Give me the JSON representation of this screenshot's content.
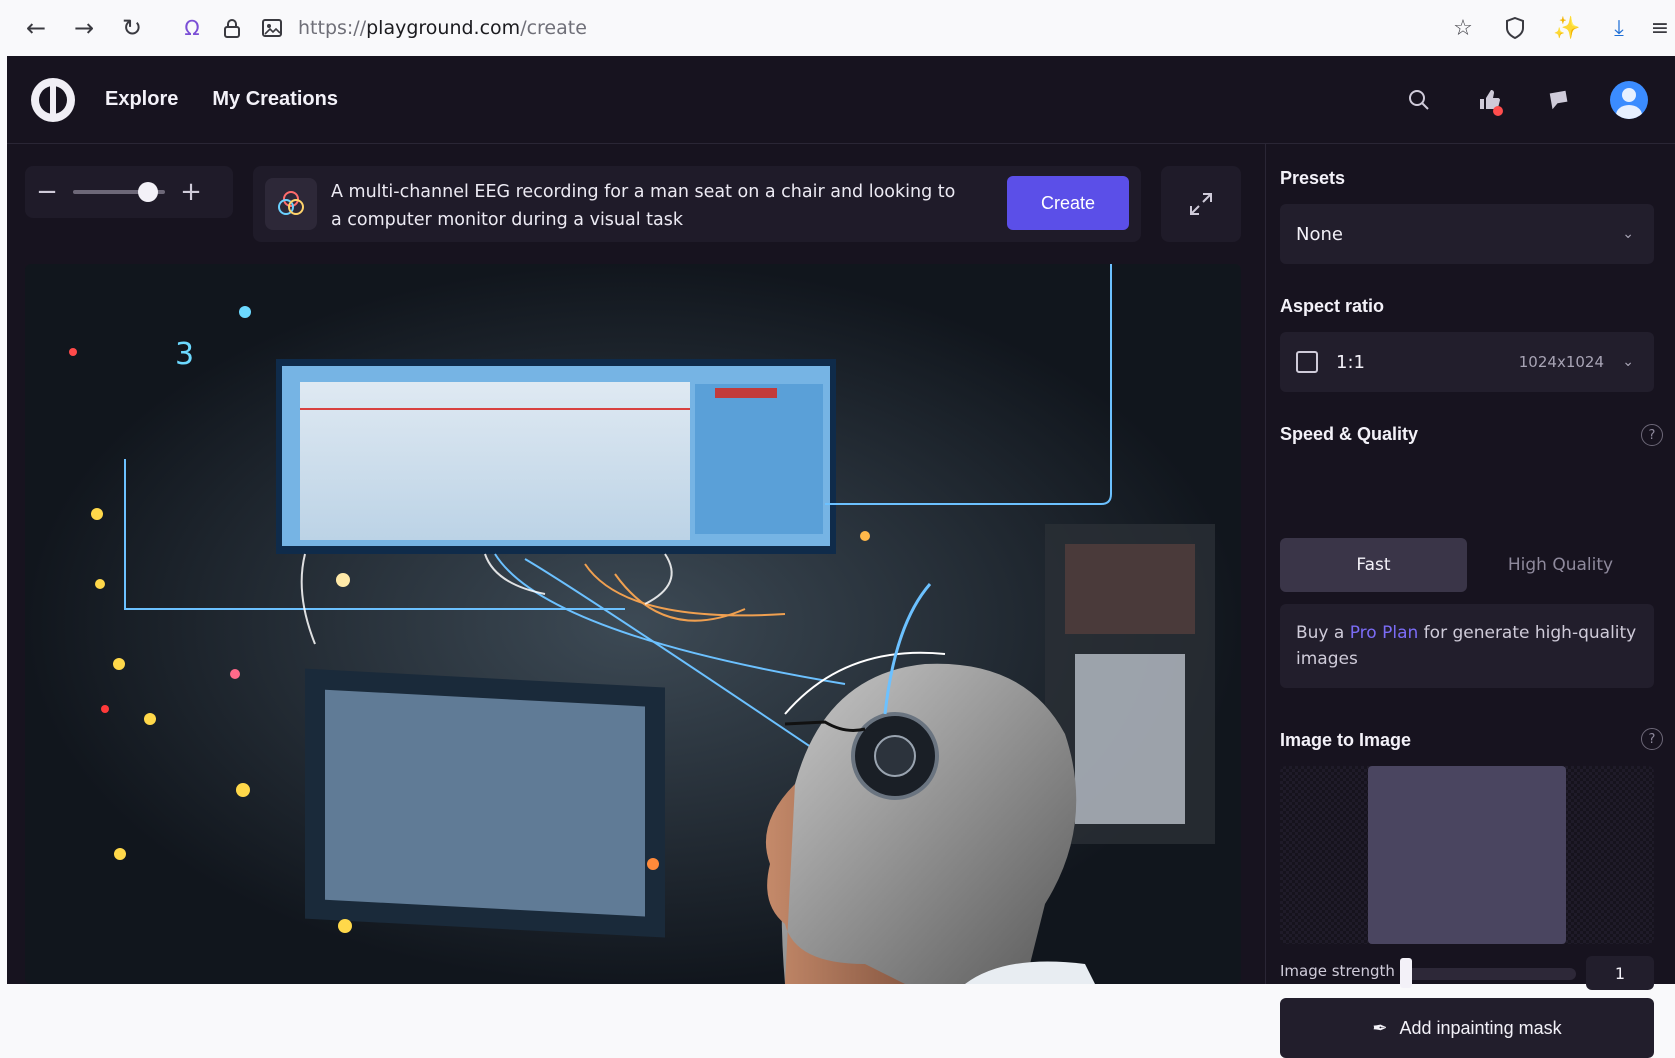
{
  "browser": {
    "url_prefix": "https://",
    "url_host": "playground.com",
    "url_path": "/create",
    "icons": [
      "back-arrow-icon",
      "forward-arrow-icon",
      "reload-icon",
      "site-info-icon",
      "lock-icon",
      "permissions-icon",
      "bookmark-star-icon",
      "shield-icon",
      "customize-icon",
      "download-icon",
      "menu-icon"
    ]
  },
  "nav": {
    "explore": "Explore",
    "my_creations": "My Creations"
  },
  "zoom": {
    "level": 0.82
  },
  "prompt": {
    "text": "A multi-channel  EEG recording for a man seat on a chair and looking to a computer monitor during a visual task",
    "create_label": "Create"
  },
  "panel": {
    "presets": {
      "title": "Presets",
      "value": "None"
    },
    "aspect_ratio": {
      "title": "Aspect ratio",
      "value": "1:1",
      "dimensions": "1024x1024"
    },
    "speed_quality": {
      "title": "Speed & Quality",
      "fast_label": "Fast",
      "high_label": "High Quality",
      "selected": "Fast",
      "pro_prefix": "Buy a ",
      "pro_link": "Pro Plan",
      "pro_suffix": " for generate high-quality images"
    },
    "image_to_image": {
      "title": "Image to Image",
      "strength_label": "Image strength",
      "strength_value": "1",
      "mask_label": "Add inpainting mask"
    },
    "help_symbol": "?"
  },
  "colors": {
    "accent": "#5b4fe8",
    "link": "#7b6cf6",
    "app_bg": "#17131f",
    "notification": "#ff4d4d"
  }
}
